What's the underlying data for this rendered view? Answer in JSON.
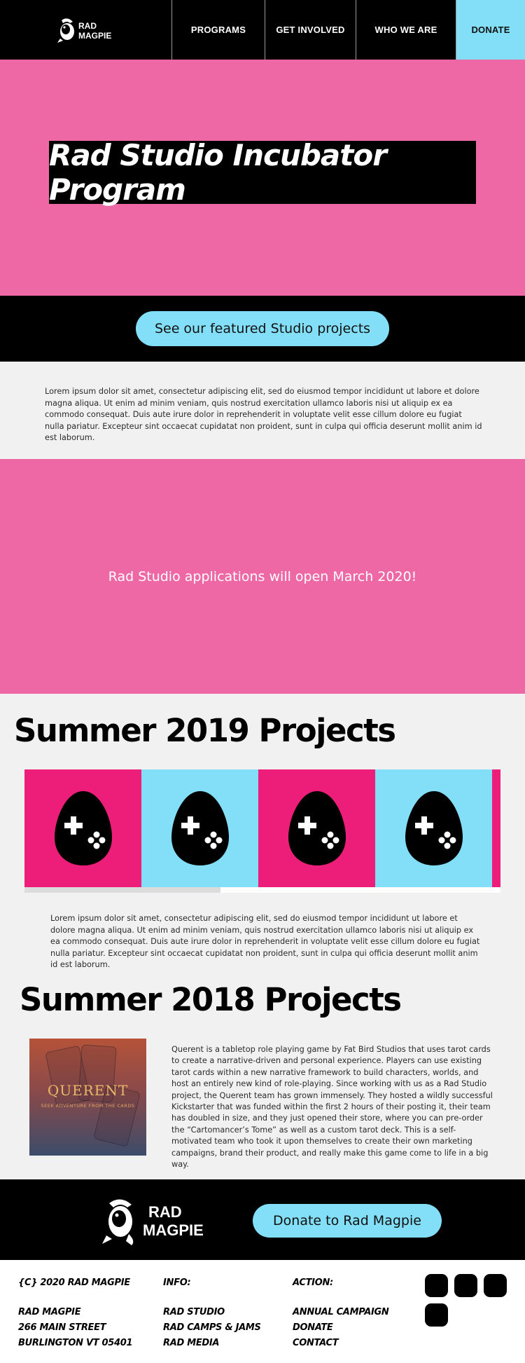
{
  "nav": {
    "logo_text": "RAD MAGPIE",
    "items": [
      {
        "label": "PROGRAMS"
      },
      {
        "label": "GET INVOLVED"
      },
      {
        "label": "WHO WE ARE"
      },
      {
        "label": "DONATE"
      }
    ]
  },
  "hero": {
    "title": "Rad Studio Incubator Program"
  },
  "cta": {
    "label": "See our featured Studio projects"
  },
  "intro": {
    "text": "Lorem ipsum dolor sit amet, consectetur adipiscing elit, sed do eiusmod tempor incididunt ut labore et dolore magna aliqua. Ut enim ad minim veniam, quis nostrud exercitation ullamco laboris nisi ut aliquip ex ea commodo consequat. Duis aute irure dolor in reprehenderit in voluptate velit esse cillum dolore eu fugiat nulla pariatur. Excepteur sint occaecat cupidatat non proident, sunt in culpa qui officia deserunt mollit anim id est laborum."
  },
  "announcement": {
    "text": "Rad Studio applications will open March 2020!"
  },
  "summer_2019": {
    "heading": "Summer 2019 Projects",
    "tiles": [
      {
        "color": "#ed1e7a",
        "icon": "game-egg-icon"
      },
      {
        "color": "#83dff7",
        "icon": "game-egg-icon"
      },
      {
        "color": "#ed1e7a",
        "icon": "game-egg-icon"
      },
      {
        "color": "#83dff7",
        "icon": "game-egg-icon"
      }
    ],
    "text": "Lorem ipsum dolor sit amet, consectetur adipiscing elit, sed do eiusmod tempor incididunt ut labore et dolore magna aliqua. Ut enim ad minim veniam, quis nostrud exercitation ullamco laboris nisi ut aliquip ex ea commodo consequat. Duis aute irure dolor in reprehenderit in voluptate velit esse cillum dolore eu fugiat nulla pariatur. Excepteur sint occaecat cupidatat non proident, sunt in culpa qui officia deserunt mollit anim id est laborum."
  },
  "summer_2018": {
    "heading": "Summer 2018 Projects",
    "project": {
      "image_title": "QUERENT",
      "image_subtitle": "SEEK ADVENTURE FROM THE CARDS",
      "description": "Querent is a tabletop role playing game by Fat Bird Studios that uses tarot cards to create a narrative-driven and personal experience. Players can use existing tarot cards within a new narrative framework to build characters, worlds, and host an entirely new kind of role-playing. Since working with us as a Rad Studio project, the Querent team has grown immensely. They hosted a wildly successful Kickstarter that was funded within the first 2 hours of their posting it, their team has doubled in size, and they just opened their store, where you can pre-order the “Cartomancer’s Tome” as well as a custom tarot deck. This is a self-motivated team who took it upon themselves to create their own marketing campaigns, brand their product, and really make this game come to life in a big way."
    }
  },
  "footer_band": {
    "logo_text": "RAD MAGPIE",
    "donate_label": "Donate to Rad Magpie"
  },
  "footer": {
    "col1": {
      "title": "{C} 2020 RAD MAGPIE",
      "lines": [
        "RAD MAGPIE",
        "266 MAIN STREET",
        "BURLINGTON VT 05401"
      ]
    },
    "col2": {
      "title": "INFO:",
      "lines": [
        "RAD STUDIO",
        "RAD CAMPS & JAMS",
        "RAD MEDIA"
      ]
    },
    "col3": {
      "title": "ACTION:",
      "lines": [
        "ANNUAL CAMPAIGN",
        "DONATE",
        "CONTACT"
      ]
    },
    "social_icons": [
      "social-icon",
      "social-icon",
      "social-icon",
      "social-icon"
    ]
  },
  "colors": {
    "pink": "#ee68a6",
    "hot_pink": "#ed1e7a",
    "sky_blue": "#83dff7",
    "black": "#000000"
  }
}
